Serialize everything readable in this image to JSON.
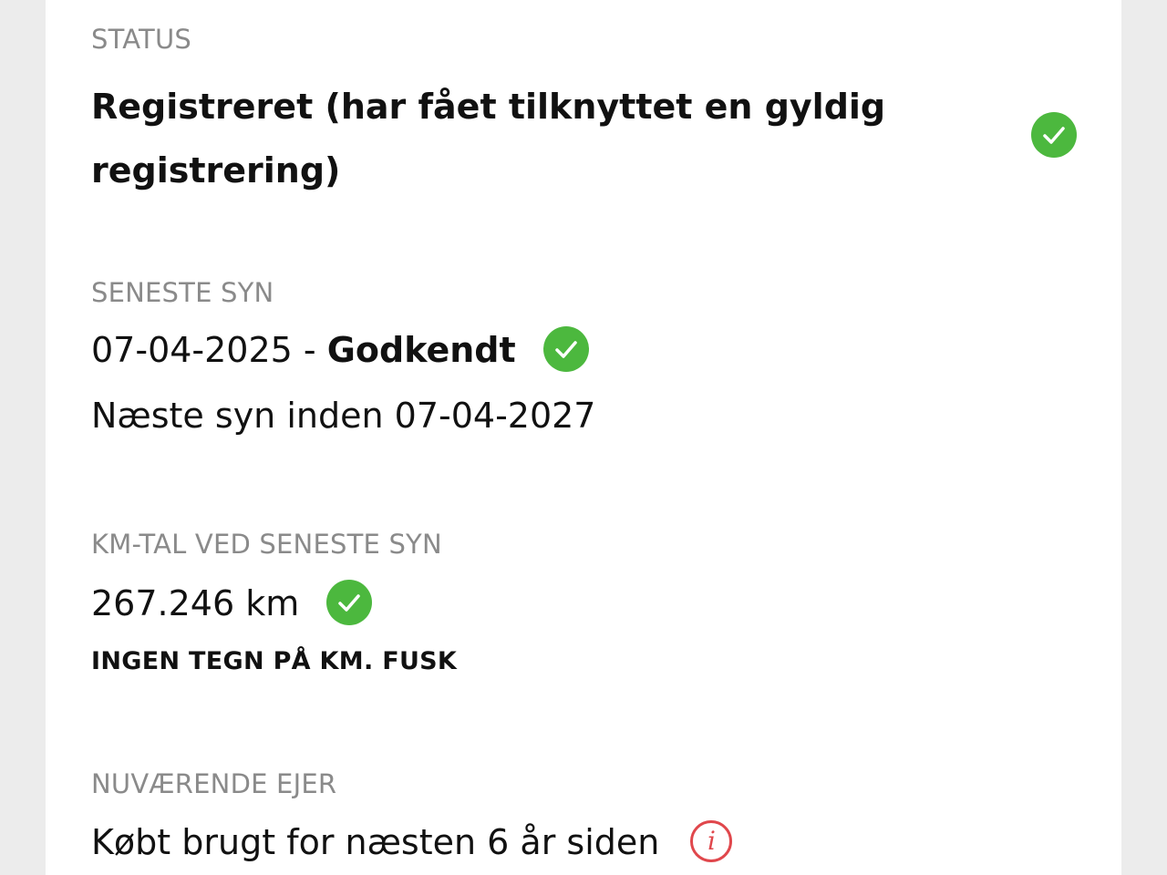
{
  "status": {
    "label": "STATUS",
    "value": "Registreret (har fået tilknyttet en gyldig registrering)",
    "icon": "check-circle-icon"
  },
  "inspection": {
    "label": "SENESTE SYN",
    "date": "07-04-2025",
    "separator": " - ",
    "result": "Godkendt",
    "next": "Næste syn inden 07-04-2027",
    "icon": "check-circle-icon"
  },
  "mileage": {
    "label": "KM-TAL VED SENESTE SYN",
    "value": "267.246 km",
    "note": "INGEN TEGN PÅ KM. FUSK",
    "icon": "check-circle-icon"
  },
  "owner": {
    "label": "NUVÆRENDE EJER",
    "value": "Købt brugt for næsten 6 år siden",
    "icon": "info-icon",
    "info_glyph": "i"
  },
  "colors": {
    "check": "#4cb83e",
    "info": "#e0474c",
    "label": "#8a8a8a",
    "text": "#111111"
  }
}
